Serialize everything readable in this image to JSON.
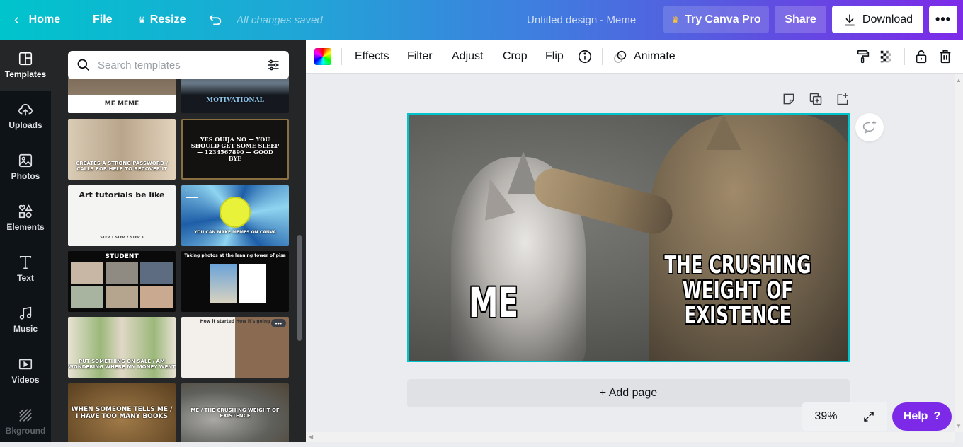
{
  "topbar": {
    "home": "Home",
    "file": "File",
    "resize": "Resize",
    "saved_status": "All changes saved",
    "design_title": "Untitled design - Meme",
    "try_pro": "Try Canva Pro",
    "share": "Share",
    "download": "Download",
    "more": "•••"
  },
  "rail": {
    "items": [
      {
        "label": "Templates",
        "icon": "templates-icon",
        "active": true
      },
      {
        "label": "Uploads",
        "icon": "upload-cloud-icon"
      },
      {
        "label": "Photos",
        "icon": "image-icon"
      },
      {
        "label": "Elements",
        "icon": "shapes-icon"
      },
      {
        "label": "Text",
        "icon": "text-icon"
      },
      {
        "label": "Music",
        "icon": "music-note-icon"
      },
      {
        "label": "Videos",
        "icon": "video-icon"
      },
      {
        "label": "Bkground",
        "icon": "background-pattern-icon"
      }
    ]
  },
  "panel": {
    "search_placeholder": "Search templates",
    "templates": [
      {
        "caption": "ME   MEME",
        "bg": "#6b5a48"
      },
      {
        "caption": "MOTIVATIONAL",
        "bg": "#15191f"
      },
      {
        "caption": "CREATES A STRONG PASSWORD / CALLS FOR HELP TO RECOVER IT",
        "bg": "#c9b9a0"
      },
      {
        "caption": "YES  OUIJA  NO — YOU SHOULD GET SOME SLEEP — 1234567890 — GOOD BYE",
        "bg": "#141210"
      },
      {
        "caption": "Art tutorials be like",
        "sub": "STEP 1   STEP 2   STEP 3",
        "bg": "#f4f4f2"
      },
      {
        "caption": "YOU CAN MAKE MEMES ON CANVA",
        "bg": "#2a6fb5"
      },
      {
        "caption": "STUDENT",
        "bg": "#0a0a0a"
      },
      {
        "caption": "Taking photos at the leaning tower of pisa",
        "bg": "#0a0a0a"
      },
      {
        "caption": "PUT SOMETHING ON SALE / AM WONDERING WHERE MY MONEY WENT",
        "bg": "#d8d1bf"
      },
      {
        "caption": "How it started   How it's going",
        "bg": "#f0ece6"
      },
      {
        "caption": "WHEN SOMEONE TELLS ME / I HAVE TOO MANY BOOKS",
        "bg": "#7a5a32"
      },
      {
        "caption": "ME / THE CRUSHING WEIGHT OF EXISTENCE",
        "bg": "#5f605c"
      }
    ],
    "more_options": "•••"
  },
  "toolbar": {
    "effects": "Effects",
    "filter": "Filter",
    "adjust": "Adjust",
    "crop": "Crop",
    "flip": "Flip",
    "animate": "Animate"
  },
  "canvas": {
    "text_left": "ME",
    "text_right_lines": [
      "THE CRUSHING",
      "WEIGHT OF",
      "EXISTENCE"
    ],
    "add_page": "+ Add page",
    "zoom_level": "39%",
    "help": "Help",
    "help_mark": "?"
  },
  "colors": {
    "accent_teal": "#00c4cc",
    "accent_purple": "#7d2ae8",
    "rail_bg": "#0e1318",
    "panel_bg": "#252627",
    "workspace_bg": "#ebecf0"
  }
}
